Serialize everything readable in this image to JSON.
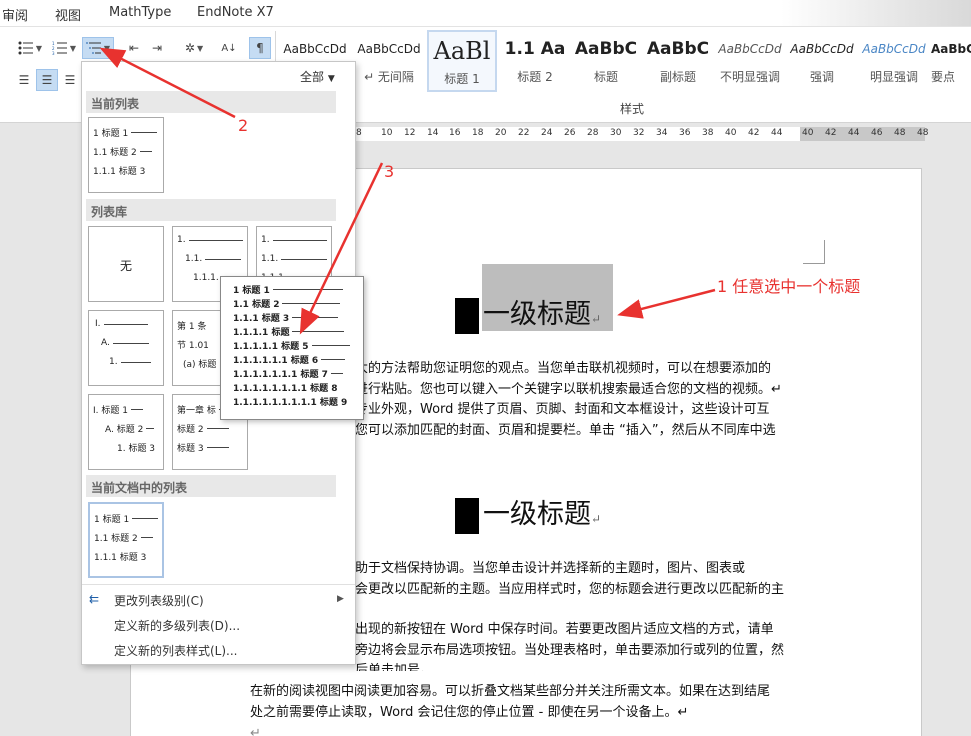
{
  "tabs": [
    "审阅",
    "视图",
    "MathType",
    "EndNote X7"
  ],
  "ribbon": {
    "styles": [
      {
        "preview": "AaBbCcDd",
        "name": ""
      },
      {
        "preview": "AaBbCcDd",
        "name": "↵ 无间隔"
      },
      {
        "preview": "AaBl",
        "name": "标题 1"
      },
      {
        "preview": "1.1 Aa",
        "name": "标题 2"
      },
      {
        "preview": "AaBbC",
        "name": "标题"
      },
      {
        "preview": "AaBbC",
        "name": "副标题"
      },
      {
        "preview": "AaBbCcDd",
        "name": "不明显强调"
      },
      {
        "preview": "AaBbCcDd",
        "name": "强调"
      },
      {
        "preview": "AaBbCcDd",
        "name": "明显强调"
      },
      {
        "preview": "AaBbCcDd",
        "name": "要点"
      }
    ],
    "styles_caption": "样式"
  },
  "ruler": [
    "8",
    "10",
    "12",
    "14",
    "16",
    "18",
    "20",
    "22",
    "24",
    "26",
    "28",
    "30",
    "32",
    "34",
    "36",
    "38",
    "40",
    "42",
    "44",
    "46",
    "48"
  ],
  "menu": {
    "filter": "全部",
    "sections": {
      "current_list": "当前列表",
      "library": "列表库",
      "in_document": "当前文档中的列表"
    },
    "none_label": "无",
    "current_tile": [
      "1 标题 1",
      "1.1 标题 2",
      "1.1.1 标题 3"
    ],
    "tile_outline": [
      "1.",
      "1.1.",
      "1.1.1."
    ],
    "tile_bullets": [
      "1.",
      "1.1.",
      "1.1.1"
    ],
    "tile_article": [
      "第 1 条",
      "节 1.01",
      "(a) 标题"
    ],
    "tile_roman": [
      "I.",
      "A.",
      "1."
    ],
    "tile_roman_heading": [
      "I. 标题 1",
      "A. 标题 2",
      "1. 标题 3"
    ],
    "tile_chapter": [
      "第一章 标",
      "标题 2",
      "标题 3"
    ],
    "doc_tile": [
      "1 标题 1",
      "1.1 标题 2",
      "1.1.1 标题 3"
    ],
    "preview_lines": [
      "1 标题 1",
      "1.1 标题 2",
      "1.1.1 标题 3",
      "1.1.1.1 标题",
      "1.1.1.1.1 标题 5",
      "1.1.1.1.1.1 标题 6",
      "1.1.1.1.1.1.1 标题 7",
      "1.1.1.1.1.1.1.1 标题 8",
      "1.1.1.1.1.1.1.1.1 标题 9"
    ],
    "items": [
      "更改列表级别(C)",
      "定义新的多级列表(D)...",
      "定义新的列表样式(L)..."
    ]
  },
  "document": {
    "heading1": "一级标题",
    "heading2": "一级标题",
    "para1": [
      "大的方法帮助您证明您的观点。当您单击联机视频时，可以在想要添加的",
      "进行粘贴。您也可以键入一个关键字以联机搜索最适合您的文档的视频。↵",
      "专业外观，Word 提供了页眉、页脚、封面和文本框设计，这些设计可互",
      "您可以添加匹配的封面、页眉和提要栏。单击 “插入”，然后从不同库中选"
    ],
    "para2": [
      "助于文档保持协调。当您单击设计并选择新的主题时，图片、图表或",
      "会更改以匹配新的主题。当应用样式时，您的标题会进行更改以匹配新的主",
      "",
      "出现的新按钮在 Word 中保存时间。若要更改图片适应文档的方式，请单",
      "旁边将会显示布局选项按钮。当处理表格时，单击要添加行或列的位置，然",
      "后单击加号。"
    ],
    "para3": [
      "在新的阅读视图中阅读更加容易。可以折叠文档某些部分并关注所需文本。如果在达到结尾",
      "处之前需要停止读取，Word 会记住您的停止位置 - 即使在另一个设备上。↵"
    ],
    "end_mark": "↵"
  },
  "annotations": {
    "a1": "1 任意选中一个标题",
    "a2": "2",
    "a3": "3"
  },
  "colors": {
    "accent": "#e8322f",
    "selection": "#c5dcf3"
  }
}
